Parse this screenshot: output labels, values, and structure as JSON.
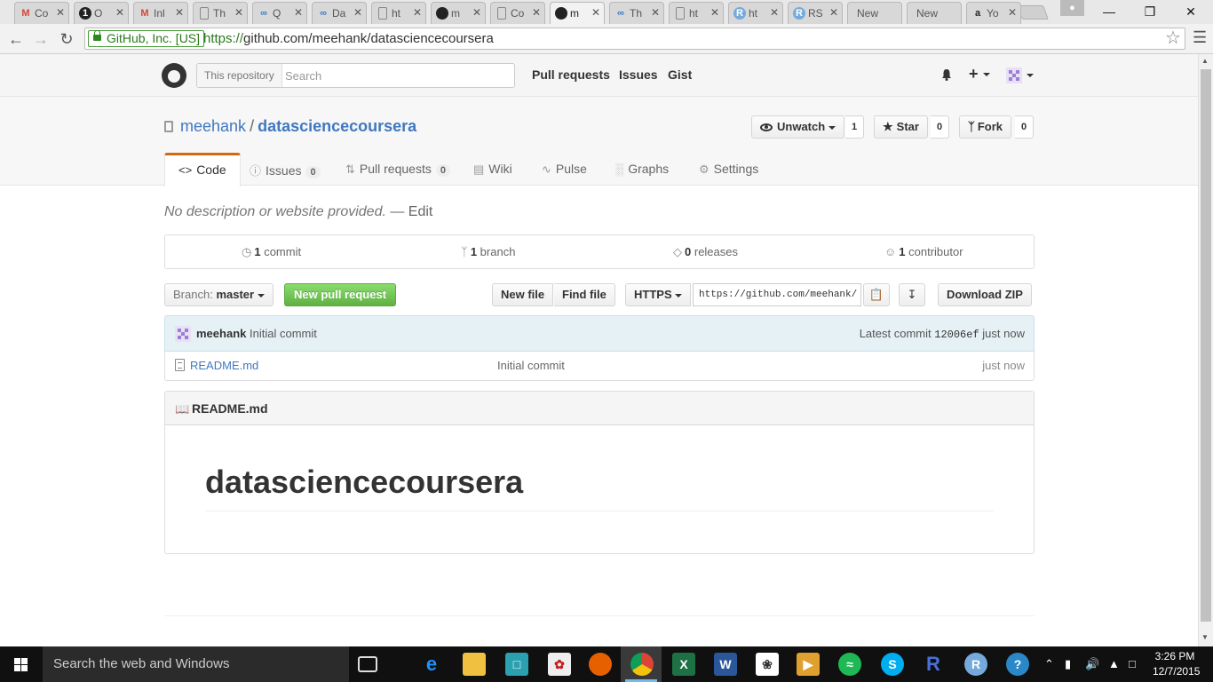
{
  "browser": {
    "tabs": [
      {
        "label": "Co",
        "icon": "gmail-icon",
        "color": "#d44638",
        "glyph": "M"
      },
      {
        "label": "O",
        "icon": "onepassword-icon",
        "color": "#222222",
        "glyph": "1"
      },
      {
        "label": "Inl",
        "icon": "gmail-icon",
        "color": "#d44638",
        "glyph": "M"
      },
      {
        "label": "Th",
        "icon": "page-icon",
        "color": "#888888",
        "glyph": ""
      },
      {
        "label": "Q",
        "icon": "infinity-icon",
        "color": "#3b7bbf",
        "glyph": "∞"
      },
      {
        "label": "Da",
        "icon": "infinity-icon",
        "color": "#3b7bbf",
        "glyph": "∞"
      },
      {
        "label": "ht",
        "icon": "page-icon",
        "color": "#888888",
        "glyph": ""
      },
      {
        "label": "m",
        "icon": "github-icon",
        "color": "#222222",
        "glyph": ""
      },
      {
        "label": "Co",
        "icon": "page-icon",
        "color": "#888888",
        "glyph": ""
      },
      {
        "label": "m",
        "icon": "github-icon",
        "color": "#222222",
        "glyph": ""
      },
      {
        "label": "Th",
        "icon": "infinity-icon",
        "color": "#3b7bbf",
        "glyph": "∞"
      },
      {
        "label": "ht",
        "icon": "page-icon",
        "color": "#888888",
        "glyph": ""
      },
      {
        "label": "ht",
        "icon": "rstudio-icon",
        "color": "#75aadb",
        "glyph": "R"
      },
      {
        "label": "RS",
        "icon": "rstudio-icon",
        "color": "#75aadb",
        "glyph": "R"
      },
      {
        "label": "New",
        "icon": "",
        "color": "",
        "glyph": ""
      },
      {
        "label": "New",
        "icon": "",
        "color": "",
        "glyph": ""
      },
      {
        "label": "Yo",
        "icon": "amazon-icon",
        "color": "#222222",
        "glyph": "a"
      }
    ],
    "ev_label": "GitHub, Inc. [US]",
    "url_scheme": "https://",
    "url_rest": "github.com/meehank/datasciencecoursera"
  },
  "header": {
    "scope_label": "This repository",
    "search_placeholder": "Search",
    "nav": [
      "Pull requests",
      "Issues",
      "Gist"
    ]
  },
  "repo": {
    "owner": "meehank",
    "separator": "/",
    "name": "datasciencecoursera",
    "unwatch_label": "Unwatch",
    "watch_count": "1",
    "star_label": "Star",
    "star_count": "0",
    "fork_label": "Fork",
    "fork_count": "0",
    "tabs": [
      {
        "label": "Code",
        "counter": ""
      },
      {
        "label": "Issues",
        "counter": "0"
      },
      {
        "label": "Pull requests",
        "counter": "0"
      },
      {
        "label": "Wiki",
        "counter": ""
      },
      {
        "label": "Pulse",
        "counter": ""
      },
      {
        "label": "Graphs",
        "counter": ""
      },
      {
        "label": "Settings",
        "counter": ""
      }
    ]
  },
  "description": {
    "text": "No description or website provided.",
    "edit": "— Edit"
  },
  "summary": {
    "commits_num": "1",
    "commits_label": "commit",
    "branches_num": "1",
    "branches_label": "branch",
    "releases_num": "0",
    "releases_label": "releases",
    "contributors_num": "1",
    "contributors_label": "contributor"
  },
  "file_nav": {
    "branch_prefix": "Branch:",
    "branch_name": "master",
    "new_pr": "New pull request",
    "new_file": "New file",
    "find_file": "Find file",
    "protocol": "HTTPS",
    "clone_url": "https://github.com/meehank/",
    "download_zip": "Download ZIP"
  },
  "commit_tease": {
    "author": "meehank",
    "message": "Initial commit",
    "latest_label": "Latest commit",
    "sha": "12006ef",
    "time": "just now"
  },
  "files": [
    {
      "name": "README.md",
      "message": "Initial commit",
      "age": "just now"
    }
  ],
  "readme": {
    "title": "README.md",
    "heading": "datasciencecoursera"
  },
  "taskbar": {
    "search_placeholder": "Search the web and Windows",
    "time": "3:26 PM",
    "date": "12/7/2015"
  },
  "colors": {
    "link": "#4078c0",
    "accent_orange": "#d26911",
    "green_button": "#60b044"
  }
}
